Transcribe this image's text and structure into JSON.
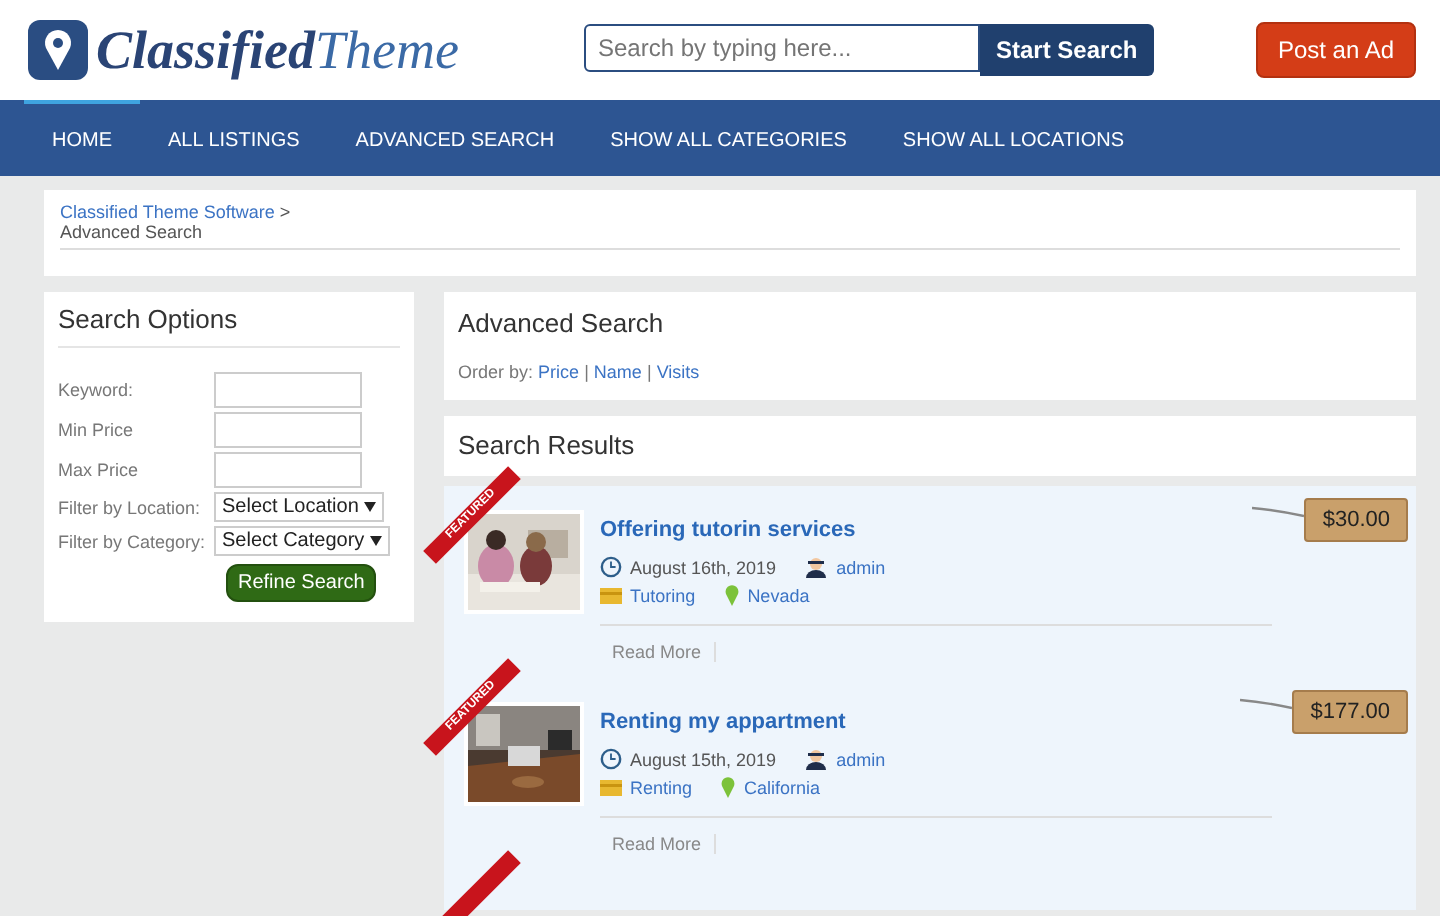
{
  "logo": {
    "part1": "Classified",
    "part2": "Theme"
  },
  "search": {
    "placeholder": "Search by typing here...",
    "button": "Start Search"
  },
  "post_button": "Post an Ad",
  "nav": [
    {
      "label": "HOME",
      "selected": true
    },
    {
      "label": "ALL LISTINGS",
      "selected": false
    },
    {
      "label": "ADVANCED SEARCH",
      "selected": false
    },
    {
      "label": "SHOW ALL CATEGORIES",
      "selected": false
    },
    {
      "label": "SHOW ALL LOCATIONS",
      "selected": false
    }
  ],
  "breadcrumb": {
    "link": "Classified Theme Software",
    "separator": ">",
    "current": "Advanced Search"
  },
  "search_options": {
    "title": "Search Options",
    "fields": [
      {
        "label": "Keyword:",
        "kind": "text"
      },
      {
        "label": "Min Price",
        "kind": "text"
      },
      {
        "label": "Max Price",
        "kind": "text"
      },
      {
        "label": "Filter by Location:",
        "kind": "select",
        "value": "Select Location"
      },
      {
        "label": "Filter by Category:",
        "kind": "select",
        "value": "Select Category"
      }
    ],
    "button": "Refine Search"
  },
  "advanced_search": {
    "title": "Advanced Search",
    "order_label": "Order by:",
    "order_links": [
      "Price",
      "Name",
      "Visits"
    ],
    "order_separator": "|"
  },
  "results": {
    "title": "Search Results",
    "listings": [
      {
        "kind": "full",
        "badge": "FEATURED",
        "title": "Offering tutorin services",
        "date": "August 16th, 2019",
        "author": "admin",
        "category": "Tutoring",
        "location": "Nevada",
        "read_more": "Read More",
        "price": "$30.00"
      },
      {
        "kind": "full",
        "badge": "FEATURED",
        "title": "Renting my appartment",
        "date": "August 15th, 2019",
        "author": "admin",
        "category": "Renting",
        "location": "California",
        "read_more": "Read More",
        "price": "$177.00"
      },
      {
        "kind": "partial"
      }
    ]
  }
}
